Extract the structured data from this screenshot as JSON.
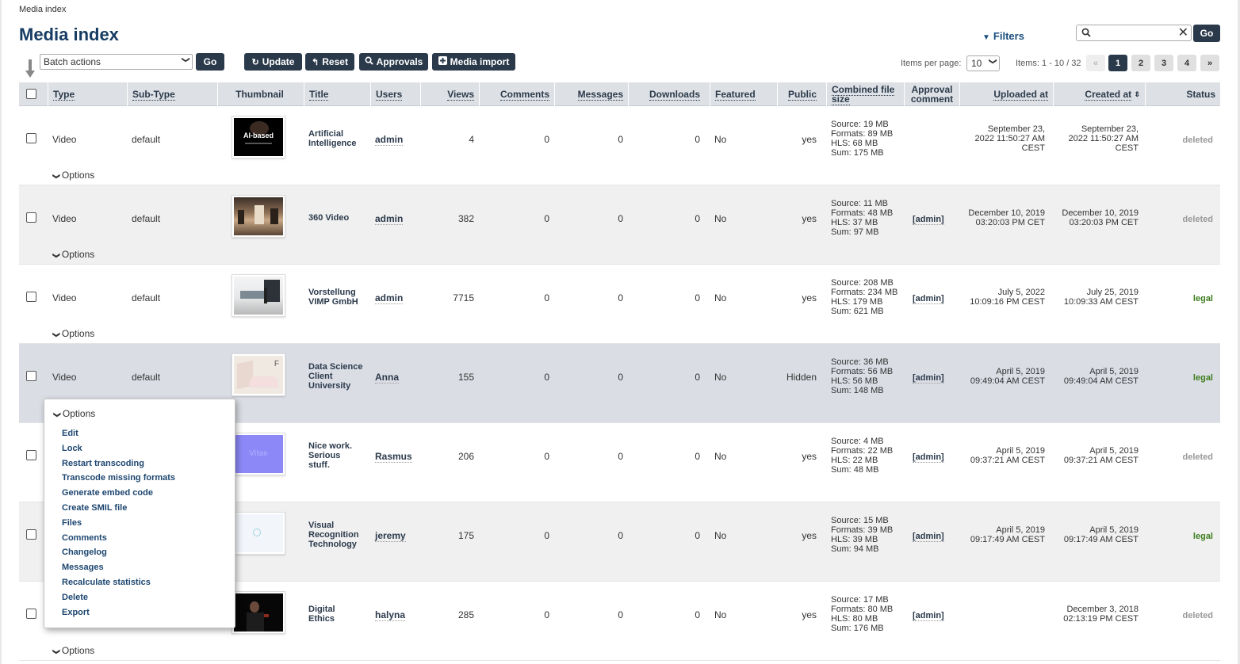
{
  "breadcrumb": "Media index",
  "page_title": "Media index",
  "filters_label": "Filters",
  "search": {
    "value": "",
    "go": "Go"
  },
  "toolbar": {
    "batch_actions": "Batch actions",
    "batch_go": "Go",
    "update": "Update",
    "reset": "Reset",
    "approvals": "Approvals",
    "media_import": "Media import"
  },
  "pagination": {
    "items_per_page_label": "Items per page:",
    "items_per_page": "10",
    "items_count": "Items: 1 - 10 / 32",
    "prev": "«",
    "pages": [
      "1",
      "2",
      "3",
      "4"
    ],
    "next": "»",
    "active": "1"
  },
  "columns": {
    "type": "Type",
    "subtype": "Sub-Type",
    "thumbnail": "Thumbnail",
    "title": "Title",
    "users": "Users",
    "views": "Views",
    "comments": "Comments",
    "messages": "Messages",
    "downloads": "Downloads",
    "featured": "Featured",
    "public": "Public",
    "combined_1": "Combined file",
    "combined_2": "size",
    "approval_1": "Approval",
    "approval_2": "comment",
    "uploaded": "Uploaded at",
    "created": "Created at",
    "status": "Status"
  },
  "rows": [
    {
      "type": "Video",
      "subtype": "default",
      "title": [
        "Artificial",
        "Intelligence"
      ],
      "user": "admin",
      "views": "4",
      "comments": "0",
      "messages": "0",
      "downloads": "0",
      "featured": "No",
      "public": "yes",
      "size": [
        "Source: 19 MB",
        "Formats: 89 MB",
        "HLS: 68 MB",
        "Sum: 175 MB"
      ],
      "approval": "",
      "uploaded": [
        "September 23,",
        "2022 11:50:27 AM",
        "CEST"
      ],
      "created": [
        "September 23,",
        "2022 11:50:27 AM",
        "CEST"
      ],
      "status": "deleted",
      "options": "Options",
      "thumb": "AI-based"
    },
    {
      "type": "Video",
      "subtype": "default",
      "title": [
        "360 Video"
      ],
      "user": "admin",
      "views": "382",
      "comments": "0",
      "messages": "0",
      "downloads": "0",
      "featured": "No",
      "public": "yes",
      "size": [
        "Source: 11 MB",
        "Formats: 48 MB",
        "HLS: 37 MB",
        "Sum: 97 MB"
      ],
      "approval": "[admin]",
      "uploaded": [
        "December 10, 2019",
        "03:20:03 PM CET"
      ],
      "created": [
        "December 10, 2019",
        "03:20:03 PM CET"
      ],
      "status": "deleted",
      "options": "Options",
      "thumb": ""
    },
    {
      "type": "Video",
      "subtype": "default",
      "title": [
        "Vorstellung",
        "VIMP GmbH"
      ],
      "user": "admin",
      "views": "7715",
      "comments": "0",
      "messages": "0",
      "downloads": "0",
      "featured": "No",
      "public": "yes",
      "size": [
        "Source: 208 MB",
        "Formats: 234 MB",
        "HLS: 179 MB",
        "Sum: 621 MB"
      ],
      "approval": "[admin]",
      "uploaded": [
        "July 5, 2022",
        "10:09:16 PM CEST"
      ],
      "created": [
        "July 25, 2019",
        "10:09:33 AM CEST"
      ],
      "status": "legal",
      "options": "Options",
      "thumb": ""
    },
    {
      "type": "Video",
      "subtype": "default",
      "title": [
        "Data Science",
        "Client",
        "University"
      ],
      "user": "Anna",
      "views": "155",
      "comments": "0",
      "messages": "0",
      "downloads": "0",
      "featured": "No",
      "public": "Hidden",
      "size": [
        "Source: 36 MB",
        "Formats: 56 MB",
        "HLS: 56 MB",
        "Sum: 148 MB"
      ],
      "approval": "[admin]",
      "uploaded": [
        "April 5, 2019",
        "09:49:04 AM CEST"
      ],
      "created": [
        "April 5, 2019",
        "09:49:04 AM CEST"
      ],
      "status": "legal",
      "options": "Options",
      "thumb": ""
    },
    {
      "type": "",
      "subtype": "",
      "title": [
        "Nice work.",
        "Serious",
        "stuff."
      ],
      "user": "Rasmus",
      "views": "206",
      "comments": "0",
      "messages": "0",
      "downloads": "0",
      "featured": "No",
      "public": "yes",
      "size": [
        "Source: 4 MB",
        "Formats: 22 MB",
        "HLS: 22 MB",
        "Sum: 48 MB"
      ],
      "approval": "[admin]",
      "uploaded": [
        "April 5, 2019",
        "09:37:21 AM CEST"
      ],
      "created": [
        "April 5, 2019",
        "09:37:21 AM CEST"
      ],
      "status": "deleted",
      "options": "",
      "thumb": ""
    },
    {
      "type": "",
      "subtype": "",
      "title": [
        "Visual",
        "Recognition",
        "Technology"
      ],
      "user": "jeremy",
      "views": "175",
      "comments": "0",
      "messages": "0",
      "downloads": "0",
      "featured": "No",
      "public": "yes",
      "size": [
        "Source: 15 MB",
        "Formats: 39 MB",
        "HLS: 39 MB",
        "Sum: 94 MB"
      ],
      "approval": "[admin]",
      "uploaded": [
        "April 5, 2019",
        "09:17:49 AM CEST"
      ],
      "created": [
        "April 5, 2019",
        "09:17:49 AM CEST"
      ],
      "status": "legal",
      "options": "",
      "thumb": ""
    },
    {
      "type": "",
      "subtype": "",
      "title": [
        "Digital",
        "Ethics"
      ],
      "user": "halyna",
      "views": "285",
      "comments": "0",
      "messages": "0",
      "downloads": "0",
      "featured": "No",
      "public": "yes",
      "size": [
        "Source: 17 MB",
        "Formats: 80 MB",
        "HLS: 80 MB",
        "Sum: 176 MB"
      ],
      "approval": "[admin]",
      "uploaded": [],
      "created": [
        "December 3, 2018",
        "02:13:19 PM CEST"
      ],
      "status": "deleted",
      "options": "Options",
      "thumb": ""
    }
  ],
  "options_menu": {
    "header": "Options",
    "items": [
      "Edit",
      "Lock",
      "Restart transcoding",
      "Transcode missing formats",
      "Generate embed code",
      "Create SMIL file",
      "Files",
      "Comments",
      "Changelog",
      "Messages",
      "Recalculate statistics",
      "Delete",
      "Export"
    ]
  },
  "colors": {
    "title": "#163c63",
    "button": "#2b3a4b",
    "legal": "#3e7d1e",
    "deleted": "#999999",
    "selected_row": "#dadde4"
  }
}
